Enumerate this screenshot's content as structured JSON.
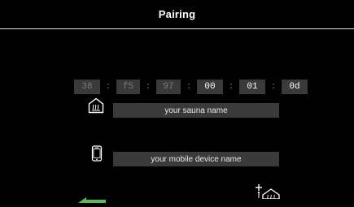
{
  "header": {
    "title": "Pairing"
  },
  "mac": {
    "octets": [
      "38",
      "f5",
      "97",
      "00",
      "01",
      "0d"
    ],
    "separator": ":"
  },
  "sauna": {
    "placeholder": "your sauna name"
  },
  "mobile": {
    "placeholder": "your mobile device name"
  },
  "icons": {
    "sauna": "sauna-house-icon",
    "phone": "mobile-phone-icon",
    "add_sauna": "add-sauna-icon",
    "back": "back-arrow-icon"
  },
  "colors": {
    "background": "#000000",
    "field": "#3a3a3a",
    "accent": "#5cb85c",
    "dim_text": "#7a7a7a"
  }
}
